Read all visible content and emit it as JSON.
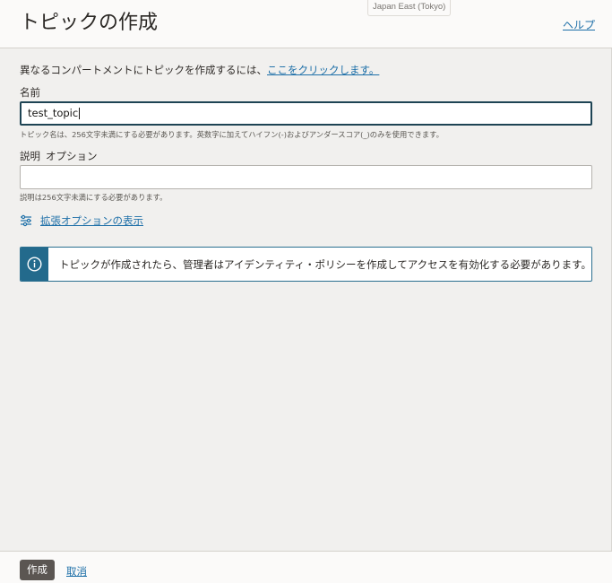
{
  "header": {
    "title": "トピックの作成",
    "region": "Japan East (Tokyo)",
    "help_label": "ヘルプ"
  },
  "intro": {
    "text": "異なるコンパートメントにトピックを作成するには、",
    "link_label": "ここをクリックします。"
  },
  "name_field": {
    "label": "名前",
    "value": "test_topic",
    "hint": "トピック名は、256文字未満にする必要があります。英数字に加えてハイフン(-)およびアンダースコア(_)のみを使用できます。"
  },
  "description_field": {
    "label": "説明",
    "optional_label": "オプション",
    "value": "",
    "hint": "説明は256文字未満にする必要があります。"
  },
  "advanced_options": {
    "label": "拡張オプションの表示",
    "icon": "sliders-icon"
  },
  "info": {
    "icon": "info-icon",
    "text": "トピックが作成されたら、管理者はアイデンティティ・ポリシーを作成してアクセスを有効化する必要があります。"
  },
  "footer": {
    "create_label": "作成",
    "cancel_label": "取消"
  },
  "colors": {
    "link": "#1d6fa8",
    "primary_button": "#5b5652",
    "info_accent": "#236a8c",
    "focus_border": "#1e4454",
    "background": "#f1f0ee"
  }
}
